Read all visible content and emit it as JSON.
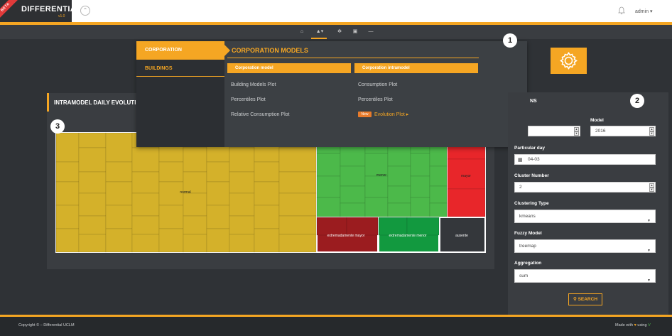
{
  "brand": {
    "name": "DIFFERENTIAL",
    "version": "v1.0",
    "beta": "BETA"
  },
  "header": {
    "user": "admin ▾"
  },
  "megamenu": {
    "tabs": [
      "CORPORATION",
      "BUILDINGS"
    ],
    "title": "CORPORATION MODELS",
    "col1": {
      "header": "Corporation model",
      "links": [
        "Building Models Plot",
        "Percentiles Plot",
        "Relative Consumption Plot"
      ]
    },
    "col2": {
      "header": "Corporation intramodel",
      "links": [
        "Consumption Plot",
        "Percentiles Plot"
      ],
      "badge": "New",
      "featured": "Evolution Plot ▸"
    }
  },
  "badges": [
    "1",
    "2",
    "3"
  ],
  "main": {
    "title": "INTRAMODEL DAILY EVOLUTI"
  },
  "treemap": {
    "labels": [
      "normal",
      "menor",
      "mayor",
      "extremadamente mayor",
      "extremadamente menor",
      "ausente"
    ],
    "colors": {
      "normal": "#d4b12a",
      "menor": "#4cb94a",
      "mayor": "#e8262a",
      "ext_mayor": "#9b1c1f",
      "ext_menor": "#12993f",
      "ausente": "#34373b"
    }
  },
  "form": {
    "title": "NS",
    "year_label": "",
    "year_value": "",
    "model_label": "Model",
    "model_value": "2016",
    "day_label": "Particular day",
    "day_value": "04-03",
    "cluster_label": "Cluster Number",
    "cluster_value": "2",
    "clustering_label": "Clustering Type",
    "clustering_value": "kmeans",
    "fuzzy_label": "Fuzzy Model",
    "fuzzy_value": "treemap",
    "agg_label": "Aggregation",
    "agg_value": "sum",
    "search": "SEARCH"
  },
  "footer": {
    "copyright": "Copyright © – Differential UCLM",
    "made_with": "Made with",
    "using": "using"
  },
  "colors": {
    "accent": "#f5a623",
    "panel": "#3a3d41",
    "background": "#2f3236"
  }
}
